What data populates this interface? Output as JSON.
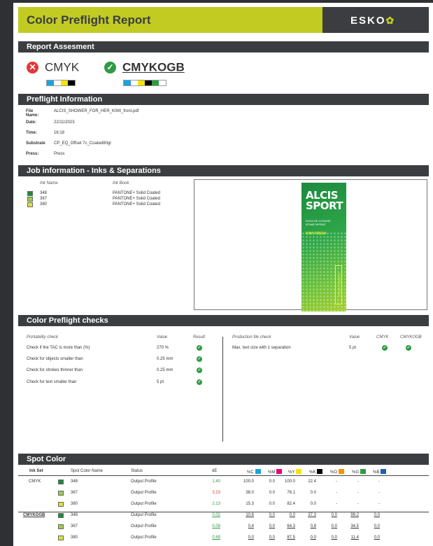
{
  "header": {
    "title": "Color Preflight Report",
    "logo": "ESKO"
  },
  "sections": {
    "assessment": "Report Assesment",
    "preflight_info": "Preflight Information",
    "job_info": "Job information - Inks & Separations",
    "checks": "Color Preflight checks",
    "spot": "Spot Color"
  },
  "assessment": {
    "items": [
      {
        "label": "CMYK",
        "status": "fail",
        "swatches": [
          "#1aa3e0",
          "#ffffff",
          "#f5e400",
          "#000000"
        ]
      },
      {
        "label": "CMYKOGB",
        "status": "pass",
        "swatches": [
          "#1aa3e0",
          "#ffffff",
          "#f5e400",
          "#000000",
          "#2e9b44",
          "#ffffff"
        ]
      }
    ]
  },
  "preflight": [
    {
      "key": "File Name:",
      "value": "ALCIS_SHOWER_FOR_HER_KIWI_front.pdf"
    },
    {
      "key": "Date:",
      "value": "22/11/2023"
    },
    {
      "key": "Time:",
      "value": "16:18"
    },
    {
      "key": "Substrate",
      "value": "CP_EQ_Offset 7c_Coated80gr"
    },
    {
      "key": "Press:",
      "value": "Press"
    }
  ],
  "inks": {
    "headers": {
      "name": "Ink Name",
      "book": "Ink Book"
    },
    "rows": [
      {
        "name": "348",
        "book": "PANTONE+ Solid Coated",
        "color": "#1e8a3a"
      },
      {
        "name": "367",
        "book": "PANTONE+ Solid Coated",
        "color": "#9fcb4c"
      },
      {
        "name": "380",
        "book": "PANTONE+ Solid Coated",
        "color": "#dbe33a"
      }
    ]
  },
  "preview": {
    "brand_line1": "ALCIS",
    "brand_line2": "SPORT",
    "tagline1": "DOUCHE COUDSE",
    "tagline2": "ATNAE NPEWZ",
    "kiwi": "KIWI FRESH",
    "vertical": "POUR FEMMES"
  },
  "checks": {
    "left_headers": {
      "check": "Printability check",
      "value": "Value",
      "result": "Result"
    },
    "left_rows": [
      {
        "check": "Check if the TAC is more than (%)",
        "value": "270 %"
      },
      {
        "check": "Check for objects smaller than",
        "value": "0.25 mm"
      },
      {
        "check": "Check for strokes thinner than",
        "value": "0.25 mm"
      },
      {
        "check": "Check for text smaller than",
        "value": "5 pt"
      }
    ],
    "right_headers": {
      "check": "Production file check",
      "value": "Value",
      "cmyk": "CMYK",
      "cmykogb": "CMYKOGB"
    },
    "right_rows": [
      {
        "check": "Max. text size with 1 separation",
        "value": "5 pt"
      }
    ]
  },
  "spot": {
    "headers": {
      "inkset": "Ink Set",
      "name": "Spot Color Name",
      "status": "Status",
      "de": "dE",
      "c": "%C",
      "m": "%M",
      "y": "%Y",
      "k": "%K",
      "o": "%O",
      "g": "%G",
      "b": "%B"
    },
    "header_colors": {
      "c": "#1aa3e0",
      "m": "#e6007e",
      "y": "#f5e400",
      "k": "#000000",
      "o": "#f39200",
      "g": "#2e9b44",
      "b": "#1d5fb0"
    },
    "rows": [
      {
        "inkset": "CMYK",
        "name": "348",
        "status": "Output Profile",
        "de": "1.40",
        "c": "100.0",
        "m": "0.0",
        "y": "100.0",
        "k": "22.4",
        "o": "-",
        "g": "-",
        "b": "-"
      },
      {
        "inkset": "",
        "name": "367",
        "status": "Output Profile",
        "de": "3.23",
        "c": "38.0",
        "m": "0.0",
        "y": "76.1",
        "k": "0.0",
        "o": "-",
        "g": "-",
        "b": "-"
      },
      {
        "inkset": "",
        "name": "380",
        "status": "Output Profile",
        "de": "2.13",
        "c": "15.3",
        "m": "0.0",
        "y": "82.4",
        "k": "0.0",
        "o": "-",
        "g": "-",
        "b": "-"
      },
      {
        "inkset": "CMYKOGB",
        "name": "348",
        "status": "Output Profile",
        "de": "0.02",
        "c": "10.6",
        "m": "0.0",
        "y": "0.0",
        "k": "37.3",
        "o": "0.0",
        "g": "99.2",
        "b": "0.0"
      },
      {
        "inkset": "",
        "name": "367",
        "status": "Output Profile",
        "de": "0.08",
        "c": "0.4",
        "m": "0.0",
        "y": "64.3",
        "k": "0.8",
        "o": "0.0",
        "g": "34.5",
        "b": "0.0"
      },
      {
        "inkset": "",
        "name": "380",
        "status": "Output Profile",
        "de": "0.69",
        "c": "0.0",
        "m": "0.0",
        "y": "87.5",
        "k": "0.0",
        "o": "0.0",
        "g": "11.4",
        "b": "0.0"
      }
    ],
    "row_colors": [
      "#1e8a3a",
      "#9fcb4c",
      "#dbe33a",
      "#1e8a3a",
      "#9fcb4c",
      "#dbe33a"
    ]
  }
}
